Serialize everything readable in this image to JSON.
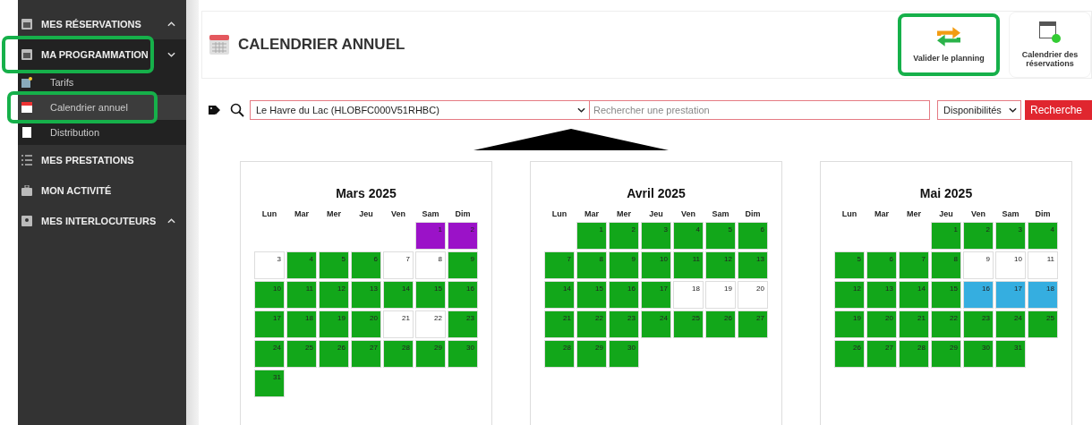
{
  "sidebar": {
    "items": [
      {
        "label": "MES RÉSERVATIONS",
        "expanded": false,
        "highlighted": false
      },
      {
        "label": "MA PROGRAMMATION",
        "expanded": true,
        "highlighted": true,
        "children": [
          {
            "label": "Tarifs",
            "selected": false,
            "highlighted": false
          },
          {
            "label": "Calendrier annuel",
            "selected": true,
            "highlighted": true
          },
          {
            "label": "Distribution",
            "selected": false,
            "highlighted": false
          }
        ]
      },
      {
        "label": "MES PRESTATIONS",
        "highlighted": false
      },
      {
        "label": "MON ACTIVITÉ",
        "highlighted": false
      },
      {
        "label": "MES INTERLOCUTEURS",
        "expanded": false,
        "highlighted": false
      }
    ]
  },
  "header": {
    "title": "CALENDRIER ANNUEL",
    "actions": [
      {
        "label": "Valider le planning",
        "highlighted": true
      },
      {
        "label": "Calendrier des réservations",
        "highlighted": false
      }
    ]
  },
  "filters": {
    "establishment": "Le Havre du Lac (HLOBFC000V51RHBC)",
    "search": {
      "placeholder": "Rechercher une prestation"
    },
    "mode": "Disponibilités",
    "button": "Recherche"
  },
  "months": [
    {
      "title": "Mars 2025",
      "weekdays": [
        "Lun",
        "Mar",
        "Mer",
        "Jeu",
        "Ven",
        "Sam",
        "Dim"
      ],
      "days": [
        {
          "kind": "blank"
        },
        {
          "kind": "blank"
        },
        {
          "kind": "blank"
        },
        {
          "kind": "blank"
        },
        {
          "kind": "blank"
        },
        {
          "kind": "day",
          "label": "1",
          "color": "#9b12c8"
        },
        {
          "kind": "day",
          "label": "2",
          "color": "#9b12c8"
        },
        {
          "kind": "day",
          "label": "3",
          "color": "#ffffff"
        },
        {
          "kind": "day",
          "label": "4",
          "color": "#12a71a"
        },
        {
          "kind": "day",
          "label": "5",
          "color": "#12a71a"
        },
        {
          "kind": "day",
          "label": "6",
          "color": "#12a71a"
        },
        {
          "kind": "day",
          "label": "7",
          "color": "#ffffff"
        },
        {
          "kind": "day",
          "label": "8",
          "color": "#ffffff"
        },
        {
          "kind": "day",
          "label": "9",
          "color": "#12a71a"
        },
        {
          "kind": "day",
          "label": "10",
          "color": "#12a71a"
        },
        {
          "kind": "day",
          "label": "11",
          "color": "#12a71a"
        },
        {
          "kind": "day",
          "label": "12",
          "color": "#12a71a"
        },
        {
          "kind": "day",
          "label": "13",
          "color": "#12a71a"
        },
        {
          "kind": "day",
          "label": "14",
          "color": "#12a71a"
        },
        {
          "kind": "day",
          "label": "15",
          "color": "#12a71a"
        },
        {
          "kind": "day",
          "label": "16",
          "color": "#12a71a"
        },
        {
          "kind": "day",
          "label": "17",
          "color": "#12a71a"
        },
        {
          "kind": "day",
          "label": "18",
          "color": "#12a71a"
        },
        {
          "kind": "day",
          "label": "19",
          "color": "#12a71a"
        },
        {
          "kind": "day",
          "label": "20",
          "color": "#12a71a"
        },
        {
          "kind": "day",
          "label": "21",
          "color": "#ffffff"
        },
        {
          "kind": "day",
          "label": "22",
          "color": "#ffffff"
        },
        {
          "kind": "day",
          "label": "23",
          "color": "#12a71a"
        },
        {
          "kind": "day",
          "label": "24",
          "color": "#12a71a"
        },
        {
          "kind": "day",
          "label": "25",
          "color": "#12a71a"
        },
        {
          "kind": "day",
          "label": "26",
          "color": "#12a71a"
        },
        {
          "kind": "day",
          "label": "27",
          "color": "#12a71a"
        },
        {
          "kind": "day",
          "label": "28",
          "color": "#12a71a"
        },
        {
          "kind": "day",
          "label": "29",
          "color": "#12a71a"
        },
        {
          "kind": "day",
          "label": "30",
          "color": "#12a71a"
        },
        {
          "kind": "day",
          "label": "31",
          "color": "#12a71a"
        }
      ]
    },
    {
      "title": "Avril 2025",
      "weekdays": [
        "Lun",
        "Mar",
        "Mer",
        "Jeu",
        "Ven",
        "Sam",
        "Dim"
      ],
      "days": [
        {
          "kind": "blank"
        },
        {
          "kind": "day",
          "label": "1",
          "color": "#12a71a"
        },
        {
          "kind": "day",
          "label": "2",
          "color": "#12a71a"
        },
        {
          "kind": "day",
          "label": "3",
          "color": "#12a71a"
        },
        {
          "kind": "day",
          "label": "4",
          "color": "#12a71a"
        },
        {
          "kind": "day",
          "label": "5",
          "color": "#12a71a"
        },
        {
          "kind": "day",
          "label": "6",
          "color": "#12a71a"
        },
        {
          "kind": "day",
          "label": "7",
          "color": "#12a71a"
        },
        {
          "kind": "day",
          "label": "8",
          "color": "#12a71a"
        },
        {
          "kind": "day",
          "label": "9",
          "color": "#12a71a"
        },
        {
          "kind": "day",
          "label": "10",
          "color": "#12a71a"
        },
        {
          "kind": "day",
          "label": "11",
          "color": "#12a71a"
        },
        {
          "kind": "day",
          "label": "12",
          "color": "#12a71a"
        },
        {
          "kind": "day",
          "label": "13",
          "color": "#12a71a"
        },
        {
          "kind": "day",
          "label": "14",
          "color": "#12a71a"
        },
        {
          "kind": "day",
          "label": "15",
          "color": "#12a71a"
        },
        {
          "kind": "day",
          "label": "16",
          "color": "#12a71a"
        },
        {
          "kind": "day",
          "label": "17",
          "color": "#12a71a"
        },
        {
          "kind": "day",
          "label": "18",
          "color": "#ffffff"
        },
        {
          "kind": "day",
          "label": "19",
          "color": "#ffffff"
        },
        {
          "kind": "day",
          "label": "20",
          "color": "#ffffff"
        },
        {
          "kind": "day",
          "label": "21",
          "color": "#12a71a"
        },
        {
          "kind": "day",
          "label": "22",
          "color": "#12a71a"
        },
        {
          "kind": "day",
          "label": "23",
          "color": "#12a71a"
        },
        {
          "kind": "day",
          "label": "24",
          "color": "#12a71a"
        },
        {
          "kind": "day",
          "label": "25",
          "color": "#12a71a"
        },
        {
          "kind": "day",
          "label": "26",
          "color": "#12a71a"
        },
        {
          "kind": "day",
          "label": "27",
          "color": "#12a71a"
        },
        {
          "kind": "day",
          "label": "28",
          "color": "#12a71a"
        },
        {
          "kind": "day",
          "label": "29",
          "color": "#12a71a"
        },
        {
          "kind": "day",
          "label": "30",
          "color": "#12a71a"
        }
      ]
    },
    {
      "title": "Mai 2025",
      "weekdays": [
        "Lun",
        "Mar",
        "Mer",
        "Jeu",
        "Ven",
        "Sam",
        "Dim"
      ],
      "days": [
        {
          "kind": "blank"
        },
        {
          "kind": "blank"
        },
        {
          "kind": "blank"
        },
        {
          "kind": "day",
          "label": "1",
          "color": "#12a71a"
        },
        {
          "kind": "day",
          "label": "2",
          "color": "#12a71a"
        },
        {
          "kind": "day",
          "label": "3",
          "color": "#12a71a"
        },
        {
          "kind": "day",
          "label": "4",
          "color": "#12a71a"
        },
        {
          "kind": "day",
          "label": "5",
          "color": "#12a71a"
        },
        {
          "kind": "day",
          "label": "6",
          "color": "#12a71a"
        },
        {
          "kind": "day",
          "label": "7",
          "color": "#12a71a"
        },
        {
          "kind": "day",
          "label": "8",
          "color": "#12a71a"
        },
        {
          "kind": "day",
          "label": "9",
          "color": "#ffffff"
        },
        {
          "kind": "day",
          "label": "10",
          "color": "#ffffff"
        },
        {
          "kind": "day",
          "label": "11",
          "color": "#ffffff"
        },
        {
          "kind": "day",
          "label": "12",
          "color": "#12a71a"
        },
        {
          "kind": "day",
          "label": "13",
          "color": "#12a71a"
        },
        {
          "kind": "day",
          "label": "14",
          "color": "#12a71a"
        },
        {
          "kind": "day",
          "label": "15",
          "color": "#12a71a"
        },
        {
          "kind": "day",
          "label": "16",
          "color": "#35aee0"
        },
        {
          "kind": "day",
          "label": "17",
          "color": "#35aee0"
        },
        {
          "kind": "day",
          "label": "18",
          "color": "#35aee0"
        },
        {
          "kind": "day",
          "label": "19",
          "color": "#12a71a"
        },
        {
          "kind": "day",
          "label": "20",
          "color": "#12a71a"
        },
        {
          "kind": "day",
          "label": "21",
          "color": "#12a71a"
        },
        {
          "kind": "day",
          "label": "22",
          "color": "#12a71a"
        },
        {
          "kind": "day",
          "label": "23",
          "color": "#12a71a"
        },
        {
          "kind": "day",
          "label": "24",
          "color": "#12a71a"
        },
        {
          "kind": "day",
          "label": "25",
          "color": "#12a71a"
        },
        {
          "kind": "day",
          "label": "26",
          "color": "#12a71a"
        },
        {
          "kind": "day",
          "label": "27",
          "color": "#12a71a"
        },
        {
          "kind": "day",
          "label": "28",
          "color": "#12a71a"
        },
        {
          "kind": "day",
          "label": "29",
          "color": "#12a71a"
        },
        {
          "kind": "day",
          "label": "30",
          "color": "#12a71a"
        },
        {
          "kind": "day",
          "label": "31",
          "color": "#12a71a"
        }
      ]
    }
  ]
}
